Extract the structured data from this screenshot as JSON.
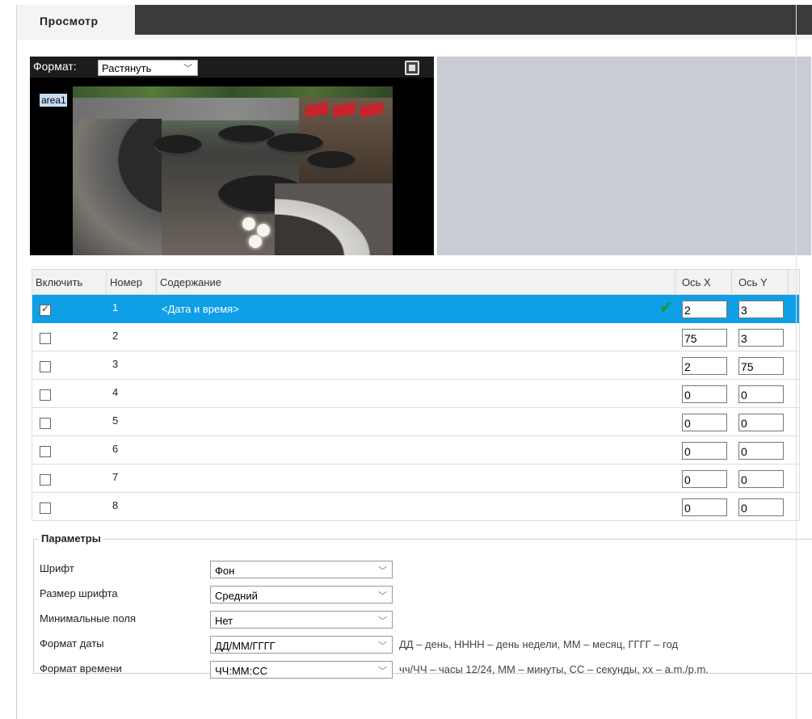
{
  "tab": {
    "label": "Просмотр"
  },
  "video": {
    "format_label": "Формат:",
    "format_value": "Растянуть",
    "area_label": "area1"
  },
  "table": {
    "headers": {
      "enable": "Включить",
      "number": "Номер",
      "content": "Содержание",
      "axis_x": "Ось X",
      "axis_y": "Ось Y"
    },
    "rows": [
      {
        "checked": true,
        "number": "1",
        "content": "<Дата и время>",
        "x": "2",
        "y": "3",
        "selected": true
      },
      {
        "checked": false,
        "number": "2",
        "content": "",
        "x": "75",
        "y": "3",
        "selected": false
      },
      {
        "checked": false,
        "number": "3",
        "content": "",
        "x": "2",
        "y": "75",
        "selected": false
      },
      {
        "checked": false,
        "number": "4",
        "content": "",
        "x": "0",
        "y": "0",
        "selected": false
      },
      {
        "checked": false,
        "number": "5",
        "content": "",
        "x": "0",
        "y": "0",
        "selected": false
      },
      {
        "checked": false,
        "number": "6",
        "content": "",
        "x": "0",
        "y": "0",
        "selected": false
      },
      {
        "checked": false,
        "number": "7",
        "content": "",
        "x": "0",
        "y": "0",
        "selected": false
      },
      {
        "checked": false,
        "number": "8",
        "content": "",
        "x": "0",
        "y": "0",
        "selected": false
      }
    ]
  },
  "params": {
    "title": "Параметры",
    "font": {
      "label": "Шрифт",
      "value": "Фон"
    },
    "font_size": {
      "label": "Размер шрифта",
      "value": "Средний"
    },
    "min_margins": {
      "label": "Минимальные поля",
      "value": "Нет"
    },
    "date_format": {
      "label": "Формат даты",
      "value": "ДД/ММ/ГГГГ",
      "hint": "ДД – день, НННН – день недели, ММ – месяц, ГГГГ – год"
    },
    "time_format": {
      "label": "Формат времени",
      "value": "ЧЧ:ММ:СС",
      "hint": "чч/ЧЧ – часы 12/24, ММ – минуты, СС – секунды, хх – a.m./p.m."
    }
  },
  "colors": {
    "selected_row": "#0e9fe6",
    "check_ok": "#1a9a2c",
    "tabbar": "#3b3b3b"
  }
}
